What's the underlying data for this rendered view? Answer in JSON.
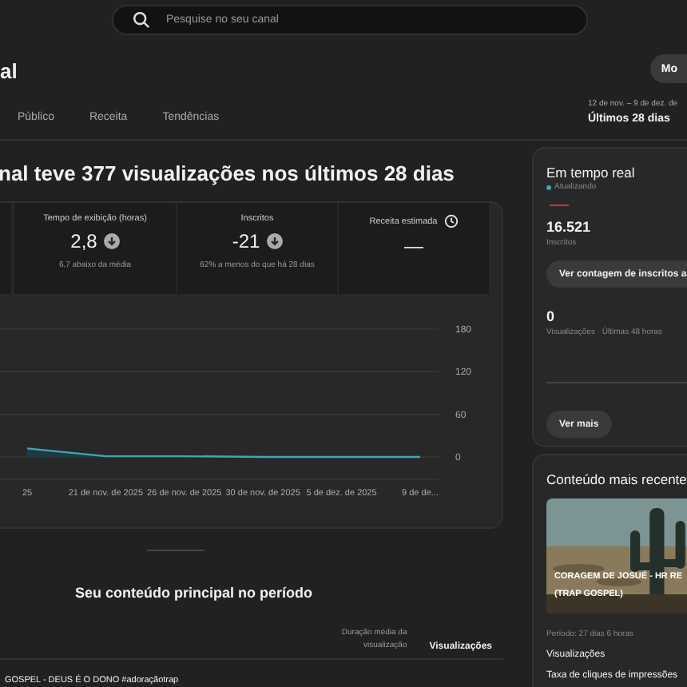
{
  "search": {
    "placeholder": "Pesquise no seu canal"
  },
  "header": {
    "title": "al",
    "button": "Mo"
  },
  "tabs": [
    {
      "label": "Público",
      "selected": false
    },
    {
      "label": "Receita",
      "selected": false
    },
    {
      "label": "Tendências",
      "selected": false
    }
  ],
  "period": {
    "range": "12 de nov. – 9 de dez. de",
    "label": "Últimos 28 dias"
  },
  "headline": "nal teve 377 visualizações nos últimos 28 dias",
  "stats": [
    {
      "label": "Tempo de exibição (horas)",
      "value": "2,8",
      "note": "6,7 abaixo da média",
      "kind": "down"
    },
    {
      "label": "Inscritos",
      "value": "-21",
      "note": "62% a menos do que há 28 dias",
      "kind": "down"
    },
    {
      "label": "Receita estimada",
      "value": "—",
      "kind": "clock"
    }
  ],
  "chart_data": {
    "type": "area",
    "categories": [
      "25",
      "21 de nov. de 2025",
      "26 de nov. de 2025",
      "30 de nov. de 2025",
      "5 de dez. de 2025",
      "9 de de..."
    ],
    "values": [
      12,
      1,
      1,
      0,
      0,
      0
    ],
    "ylim": [
      0,
      180
    ],
    "yticks": [
      0,
      60,
      120,
      180
    ]
  },
  "top_content": {
    "title": "Seu conteúdo principal no período",
    "columns": [
      "Duração média da visualização",
      "Visualizações"
    ],
    "rows": [
      {
        "title": "GOSPEL - DEUS É O DONO #adoraçãotrap"
      }
    ]
  },
  "realtime": {
    "title": "Em tempo real",
    "status": "Atualizando",
    "subscribers": "16.521",
    "subscribers_label": "Inscritos",
    "count_button": "Ver contagem de inscritos a",
    "views": "0",
    "views_label": "Visualizações · Últimas 48 horas",
    "more_button": "Ver mais"
  },
  "latest": {
    "title": "Conteúdo mais recente",
    "video_title": "CORAGEM DE JOSUÉ - HR RE",
    "video_subtitle": "(TRAP GOSPEL)",
    "period": "Período: 27 dias 6 horas",
    "metrics": [
      "Visualizações",
      "Taxa de cliques de impressões"
    ]
  }
}
